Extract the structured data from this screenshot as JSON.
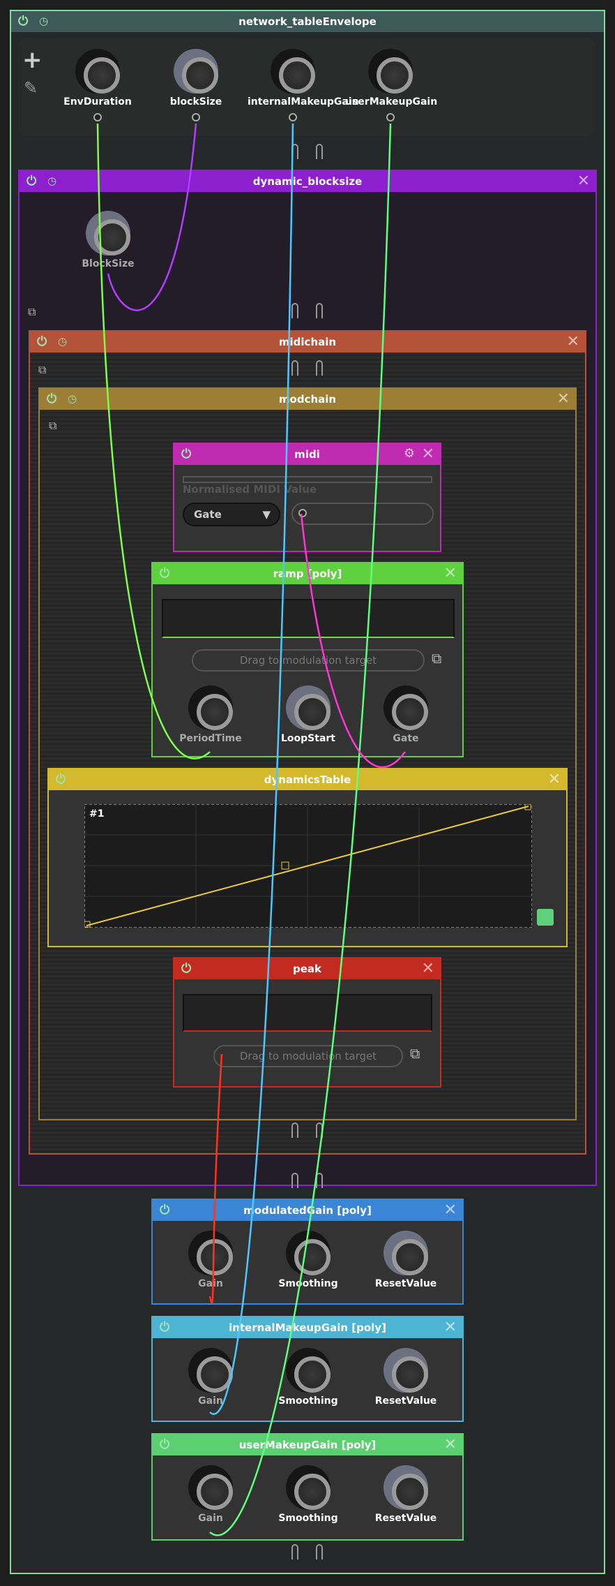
{
  "network": {
    "title": "network_tableEnvelope",
    "color": "#3d5a58",
    "params": [
      {
        "label": "EnvDuration"
      },
      {
        "label": "blockSize"
      },
      {
        "label": "internalMakeupGain"
      },
      {
        "label": "userMakeupGain"
      }
    ]
  },
  "icons": {
    "power": "⏻",
    "clock": "◷",
    "close": "✕",
    "plus": "+",
    "pencil": "✎",
    "external": "⧉",
    "midi_port": "⚙"
  },
  "dynamic_blocksize": {
    "title": "dynamic_blocksize",
    "color": "#8e1fcf",
    "knob": "BlockSize"
  },
  "midichain": {
    "title": "midichain",
    "color": "#b4533a"
  },
  "modchain": {
    "title": "modchain",
    "color": "#9c7f34"
  },
  "midi": {
    "title": "midi",
    "color": "#c02ab0",
    "value_label": "Normalised MIDI Value",
    "mode": "Gate"
  },
  "ramp": {
    "title": "ramp [poly]",
    "color": "#5fd13f",
    "drag_label": "Drag to modulation target",
    "knobs": [
      "PeriodTime",
      "LoopStart",
      "Gate"
    ]
  },
  "dynamicsTable": {
    "title": "dynamicsTable",
    "color": "#d4b92e",
    "table_index": "#1"
  },
  "peak": {
    "title": "peak",
    "color": "#c42b20",
    "drag_label": "Drag to modulation target"
  },
  "modulatedGain": {
    "title": "modulatedGain [poly]",
    "color": "#3b86d4",
    "knobs": [
      "Gain",
      "Smoothing",
      "ResetValue"
    ]
  },
  "internalMakeupGain": {
    "title": "internalMakeupGain [poly]",
    "color": "#4db4d4",
    "knobs": [
      "Gain",
      "Smoothing",
      "ResetValue"
    ]
  },
  "userMakeupGain": {
    "title": "userMakeupGain [poly]",
    "color": "#5ccf72",
    "knobs": [
      "Gain",
      "Smoothing",
      "ResetValue"
    ]
  },
  "cable_colors": {
    "env": "#7dff4a",
    "block": "#b43cff",
    "internal": "#4cc8ff",
    "user": "#5dff7e",
    "midi": "#ff35d7",
    "peak": "#ff3320"
  }
}
